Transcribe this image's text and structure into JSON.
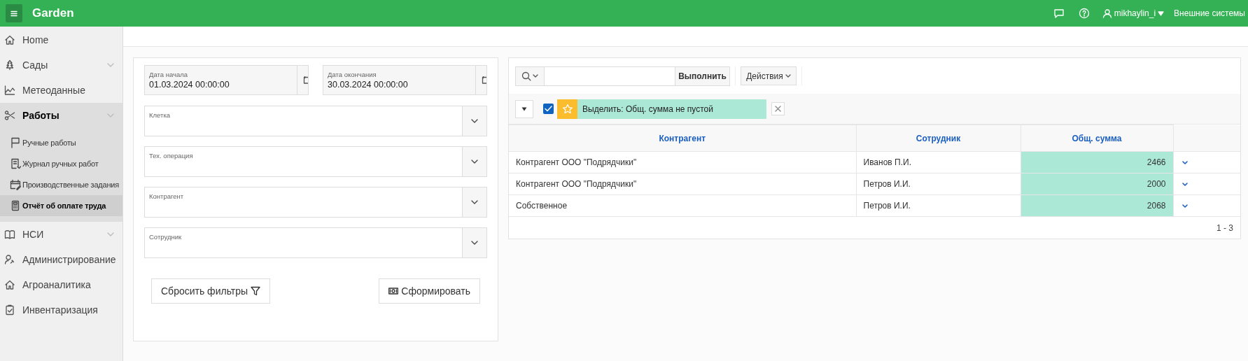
{
  "header": {
    "app_title": "Garden",
    "user": "mikhaylin_i",
    "external_systems": "Внешние системы"
  },
  "sidebar": {
    "items": [
      {
        "label": "Home",
        "expandable": false
      },
      {
        "label": "Сады",
        "expandable": true,
        "expanded": false
      },
      {
        "label": "Метеоданные",
        "expandable": false
      },
      {
        "label": "Работы",
        "expandable": true,
        "expanded": true,
        "children": [
          {
            "label": "Ручные работы",
            "selected": false
          },
          {
            "label": "Журнал ручных работ",
            "selected": false
          },
          {
            "label": "Производственные задания",
            "selected": false
          },
          {
            "label": "Отчёт об оплате труда",
            "selected": true
          }
        ]
      },
      {
        "label": "НСИ",
        "expandable": true,
        "expanded": false
      },
      {
        "label": "Администрирование",
        "expandable": false
      },
      {
        "label": "Агроаналитика",
        "expandable": false
      },
      {
        "label": "Инвентаризация",
        "expandable": false
      }
    ]
  },
  "filters": {
    "date_fields": [
      {
        "label": "Дата начала",
        "value": "01.03.2024 00:00:00"
      },
      {
        "label": "Дата окончания",
        "value": "30.03.2024 00:00:00"
      }
    ],
    "select_fields": [
      {
        "label": "Клетка"
      },
      {
        "label": "Тех. операция"
      },
      {
        "label": "Контрагент"
      },
      {
        "label": "Сотрудник"
      }
    ],
    "reset_button": "Сбросить фильтры",
    "generate_button": "Сформировать"
  },
  "report": {
    "go_button": "Выполнить",
    "actions_button": "Действия",
    "highlight_filter": {
      "checked": true,
      "label": "Выделить: Общ. сумма не пустой"
    },
    "table": {
      "columns": [
        "Контрагент",
        "Сотрудник",
        "Общ. сумма"
      ],
      "rows": [
        {
          "cells": [
            "Контрагент ООО \"Подрядчики\"",
            "Иванов П.И.",
            "2466"
          ],
          "highlighted": true
        },
        {
          "cells": [
            "Контрагент ООО \"Подрядчики\"",
            "Петров И.И.",
            "2000"
          ],
          "highlighted": true
        },
        {
          "cells": [
            "Собственное",
            "Петров И.И.",
            "2068"
          ],
          "highlighted": true
        }
      ]
    },
    "pagination": "1 - 3"
  }
}
